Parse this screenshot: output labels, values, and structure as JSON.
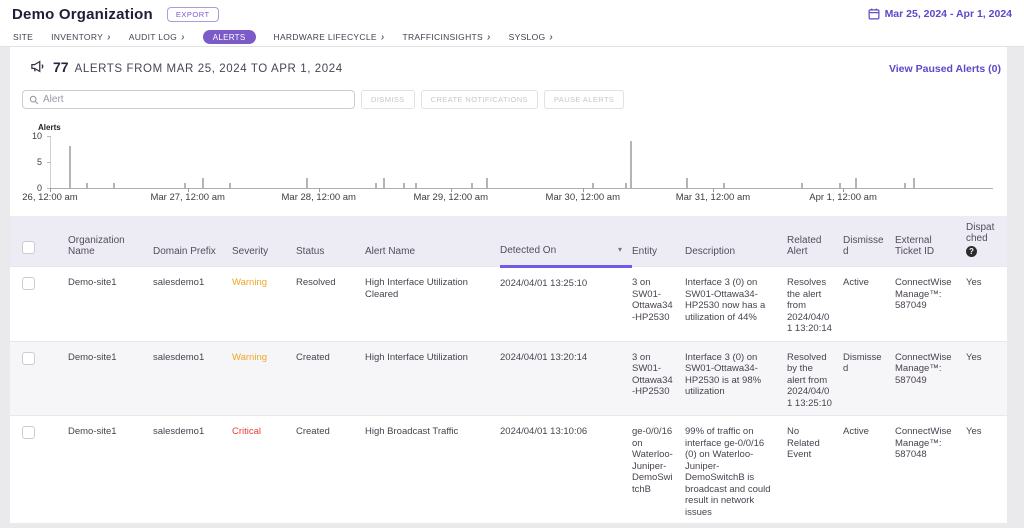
{
  "topbar": {
    "title": "Demo Organization",
    "export_label": "EXPORT",
    "date_range": "Mar 25, 2024 - Apr 1, 2024"
  },
  "nav": {
    "items": [
      {
        "label": "SITE"
      },
      {
        "label": "INVENTORY"
      },
      {
        "label": "AUDIT LOG"
      },
      {
        "label": "ALERTS",
        "active": true
      },
      {
        "label": "HARDWARE LIFECYCLE"
      },
      {
        "label": "TRAFFICINSIGHTS"
      },
      {
        "label": "SYSLOG"
      }
    ]
  },
  "alerts_header": {
    "count": "77",
    "text": "ALERTS FROM MAR 25, 2024 TO APR 1, 2024",
    "view_paused": "View Paused Alerts (0)"
  },
  "toolbar": {
    "search_placeholder": "Alert",
    "dismiss": "DISMISS",
    "create_notifications": "CREATE NOTIFICATIONS",
    "pause_alerts": "PAUSE ALERTS"
  },
  "chart_data": {
    "type": "bar",
    "ylabel": "Alerts",
    "ylim": [
      0,
      10
    ],
    "yticks": [
      0,
      5,
      10
    ],
    "xticks": [
      {
        "label": "26, 12:00 am",
        "pos_pct": 0
      },
      {
        "label": "Mar 27, 12:00 am",
        "pos_pct": 14.6
      },
      {
        "label": "Mar 28, 12:00 am",
        "pos_pct": 28.5
      },
      {
        "label": "Mar 29, 12:00 am",
        "pos_pct": 42.5
      },
      {
        "label": "Mar 30, 12:00 am",
        "pos_pct": 56.5
      },
      {
        "label": "Mar 31, 12:00 am",
        "pos_pct": 70.3
      },
      {
        "label": "Apr 1, 12:00 am",
        "pos_pct": 84.1
      }
    ],
    "bars": [
      {
        "pos_pct": 2.0,
        "count": 8
      },
      {
        "pos_pct": 3.8,
        "count": 1
      },
      {
        "pos_pct": 6.7,
        "count": 1
      },
      {
        "pos_pct": 14.2,
        "count": 1
      },
      {
        "pos_pct": 16.1,
        "count": 2
      },
      {
        "pos_pct": 19.0,
        "count": 1
      },
      {
        "pos_pct": 27.2,
        "count": 2
      },
      {
        "pos_pct": 34.5,
        "count": 1
      },
      {
        "pos_pct": 35.3,
        "count": 2
      },
      {
        "pos_pct": 37.5,
        "count": 1
      },
      {
        "pos_pct": 38.8,
        "count": 1
      },
      {
        "pos_pct": 44.7,
        "count": 1
      },
      {
        "pos_pct": 46.3,
        "count": 2
      },
      {
        "pos_pct": 57.5,
        "count": 1
      },
      {
        "pos_pct": 61.0,
        "count": 1
      },
      {
        "pos_pct": 61.6,
        "count": 9
      },
      {
        "pos_pct": 67.5,
        "count": 2
      },
      {
        "pos_pct": 71.4,
        "count": 1
      },
      {
        "pos_pct": 79.7,
        "count": 1
      },
      {
        "pos_pct": 83.8,
        "count": 1
      },
      {
        "pos_pct": 85.5,
        "count": 2
      },
      {
        "pos_pct": 90.7,
        "count": 1
      },
      {
        "pos_pct": 91.6,
        "count": 2
      }
    ]
  },
  "table": {
    "columns": [
      "Organization Name",
      "Domain Prefix",
      "Severity",
      "Status",
      "Alert Name",
      "Detected On",
      "Entity",
      "Description",
      "Related Alert",
      "Dismissed",
      "External Ticket ID",
      "Dispatched"
    ],
    "severity_colors": {
      "Warning": "#eda825",
      "Critical": "#e6403a"
    },
    "rows": [
      {
        "org": "Demo-site1",
        "domain": "salesdemo1",
        "severity": "Warning",
        "status": "Resolved",
        "alert_name": "High Interface Utilization Cleared",
        "detected_on": "2024/04/01 13:25:10",
        "entity": "3 on SW01-Ottawa34-HP2530",
        "description": "Interface 3 (0) on SW01-Ottawa34-HP2530 now has a utilization of 44%",
        "related_alert": "Resolves the alert from 2024/04/01 13:20:14",
        "dismissed": "Active",
        "external_ticket_id": "ConnectWise Manage™: 587049",
        "dispatched": "Yes"
      },
      {
        "org": "Demo-site1",
        "domain": "salesdemo1",
        "severity": "Warning",
        "status": "Created",
        "alert_name": "High Interface Utilization",
        "detected_on": "2024/04/01 13:20:14",
        "entity": "3 on SW01-Ottawa34-HP2530",
        "description": "Interface 3 (0) on SW01-Ottawa34-HP2530 is at 98% utilization",
        "related_alert": "Resolved by the alert from 2024/04/01 13:25:10",
        "dismissed": "Dismissed",
        "external_ticket_id": "ConnectWise Manage™: 587049",
        "dispatched": "Yes"
      },
      {
        "org": "Demo-site1",
        "domain": "salesdemo1",
        "severity": "Critical",
        "status": "Created",
        "alert_name": "High Broadcast Traffic",
        "detected_on": "2024/04/01 13:10:06",
        "entity": "ge-0/0/16 on Waterloo-Juniper-DemoSwitchB",
        "description": "99% of traffic on interface ge-0/0/16 (0) on Waterloo-Juniper-DemoSwitchB is broadcast and could result in network issues",
        "related_alert": "No Related Event",
        "dismissed": "Active",
        "external_ticket_id": "ConnectWise Manage™: 587048",
        "dispatched": "Yes"
      }
    ]
  },
  "colors": {
    "accent": "#7a5bc7",
    "link": "#5b49c9",
    "header_bg": "#edebf4",
    "sort_underline": "#6c5ce7"
  }
}
